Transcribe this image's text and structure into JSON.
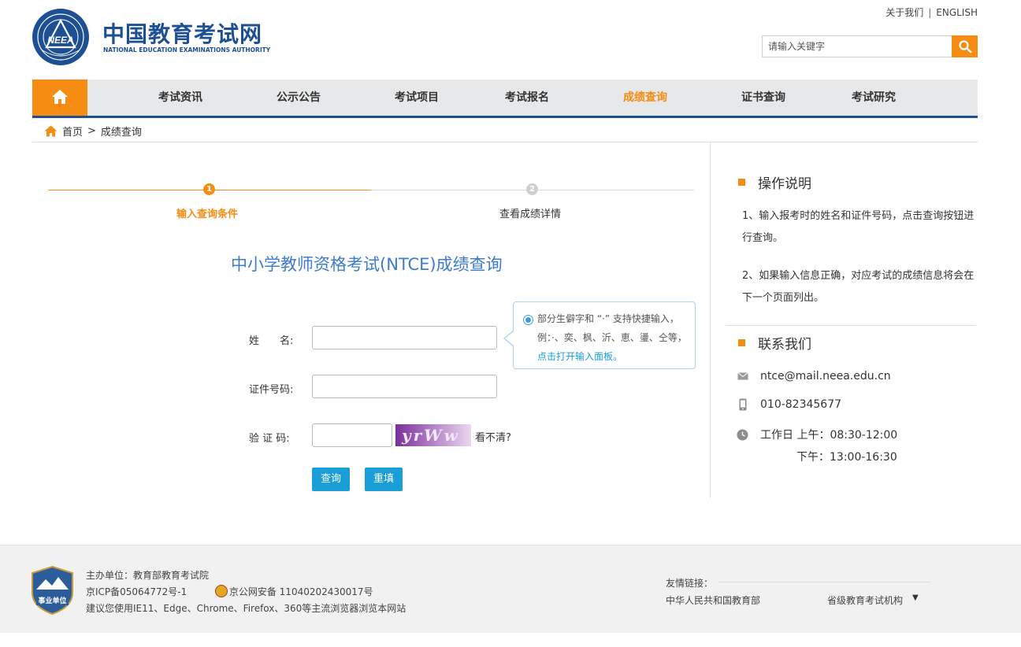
{
  "header": {
    "logo_title": "中国教育考试网",
    "logo_subtitle": "NATIONAL EDUCATION EXAMINATIONS AUTHORITY",
    "logo_emblem_text": "NEEA",
    "links": {
      "about": "关于我们",
      "separator": "|",
      "english": "ENGLISH"
    },
    "search": {
      "placeholder": "请输入关键字"
    }
  },
  "nav": {
    "items": [
      {
        "label": "考试资讯"
      },
      {
        "label": "公示公告"
      },
      {
        "label": "考试项目"
      },
      {
        "label": "考试报名"
      },
      {
        "label": "成绩查询"
      },
      {
        "label": "证书查询"
      },
      {
        "label": "考试研究"
      }
    ],
    "active_index": 4
  },
  "breadcrumb": {
    "home": "首页",
    "separator": ">",
    "current": "成绩查询"
  },
  "steps": [
    {
      "number": "1",
      "label": "输入查询条件"
    },
    {
      "number": "2",
      "label": "查看成绩详情"
    }
  ],
  "form": {
    "title": "中小学教师资格考试(NTCE)成绩查询",
    "name_label": "姓　　名:",
    "id_label": "证件号码:",
    "captcha_label": "验 证 码:",
    "name_value": "",
    "id_value": "",
    "captcha_value": "",
    "captcha_image_text": "yrWw",
    "captcha_refresh": "看不清?",
    "query_button": "查询",
    "reset_button": "重填"
  },
  "tip": {
    "text": "部分生僻字和 “·” 支持快捷输入，例：·、奕、枫、沂、恵、璗、仝等，",
    "link": "点击打开输入面板。"
  },
  "sidebar": {
    "instructions_title": "操作说明",
    "instruction_1": "1、输入报考时的姓名和证件号码，点击查询按钮进行查询。",
    "instruction_2": "2、如果输入信息正确，对应考试的成绩信息将会在下一个页面列出。",
    "contact_title": "联系我们",
    "email": "ntce@mail.neea.edu.cn",
    "phone": "010-82345677",
    "hours_am": "工作日 上午：08:30-12:00",
    "hours_pm": "下午：13:00-16:30"
  },
  "footer": {
    "badge_text": "事业单位",
    "sponsor": "主办单位：教育部教育考试院",
    "icp": "京ICP备05064772号-1",
    "police": "京公网安备 11040202430017号",
    "browser_note": "建议您使用IE11、Edge、Chrome、Firefox、360等主流浏览器浏览本网站",
    "links_title": "友情链接：",
    "link_moe": "中华人民共和国教育部",
    "link_provincial": "省级教育考试机构",
    "dropdown_arrow": "▼"
  },
  "colors": {
    "brand_blue": "#1d4f94",
    "accent_orange": "#f68c12",
    "button_blue": "#199ed8",
    "title_blue": "#3d7cc9"
  }
}
